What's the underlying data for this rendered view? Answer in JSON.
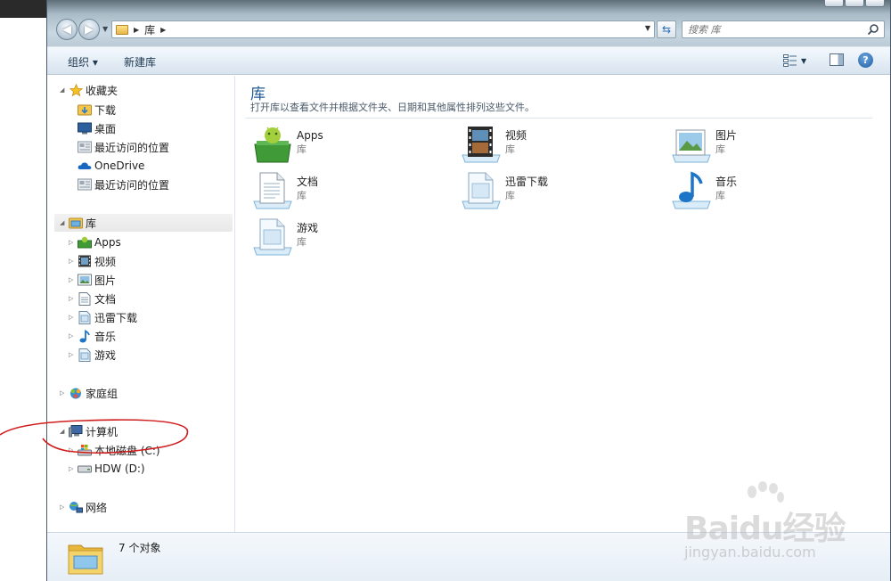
{
  "window": {
    "address": {
      "crumb": "库"
    },
    "search": {
      "placeholder": "搜索 库"
    }
  },
  "toolbar": {
    "organize_label": "组织 ▾",
    "new_library_label": "新建库"
  },
  "nav": {
    "favorites": {
      "label": "收藏夹",
      "items": [
        {
          "label": "下载",
          "icon": "download-folder-icon"
        },
        {
          "label": "桌面",
          "icon": "desktop-icon"
        },
        {
          "label": "最近访问的位置",
          "icon": "recent-places-icon"
        },
        {
          "label": "OneDrive",
          "icon": "onedrive-icon"
        },
        {
          "label": "最近访问的位置",
          "icon": "recent-places-icon"
        }
      ]
    },
    "libraries": {
      "label": "库",
      "items": [
        {
          "label": "Apps",
          "icon": "apps-library-icon"
        },
        {
          "label": "视频",
          "icon": "video-library-icon"
        },
        {
          "label": "图片",
          "icon": "pictures-library-icon"
        },
        {
          "label": "文档",
          "icon": "documents-library-icon"
        },
        {
          "label": "迅雷下载",
          "icon": "library-icon"
        },
        {
          "label": "音乐",
          "icon": "music-library-icon"
        },
        {
          "label": "游戏",
          "icon": "library-icon"
        }
      ]
    },
    "homegroup": {
      "label": "家庭组"
    },
    "computer": {
      "label": "计算机",
      "items": [
        {
          "label": "本地磁盘 (C:)",
          "icon": "local-disk-icon"
        },
        {
          "label": "HDW (D:)",
          "icon": "drive-icon"
        }
      ]
    },
    "network": {
      "label": "网络"
    }
  },
  "content": {
    "title": "库",
    "description": "打开库以查看文件并根据文件夹、日期和其他属性排列这些文件。",
    "libraries": [
      {
        "name": "Apps",
        "type": "库",
        "icon": "apps-library-icon"
      },
      {
        "name": "视频",
        "type": "库",
        "icon": "video-library-icon"
      },
      {
        "name": "图片",
        "type": "库",
        "icon": "pictures-library-icon"
      },
      {
        "name": "文档",
        "type": "库",
        "icon": "documents-library-icon"
      },
      {
        "name": "迅雷下载",
        "type": "库",
        "icon": "library-icon"
      },
      {
        "name": "音乐",
        "type": "库",
        "icon": "music-library-icon"
      },
      {
        "name": "游戏",
        "type": "库",
        "icon": "library-icon"
      }
    ]
  },
  "details": {
    "count": "7 个对象"
  },
  "watermark": {
    "brand": "Baidu经验",
    "url": "jingyan.baidu.com"
  },
  "colors": {
    "accent": "#1e5a96",
    "annotation": "#d01c1c",
    "folder": "#f3c64e"
  }
}
